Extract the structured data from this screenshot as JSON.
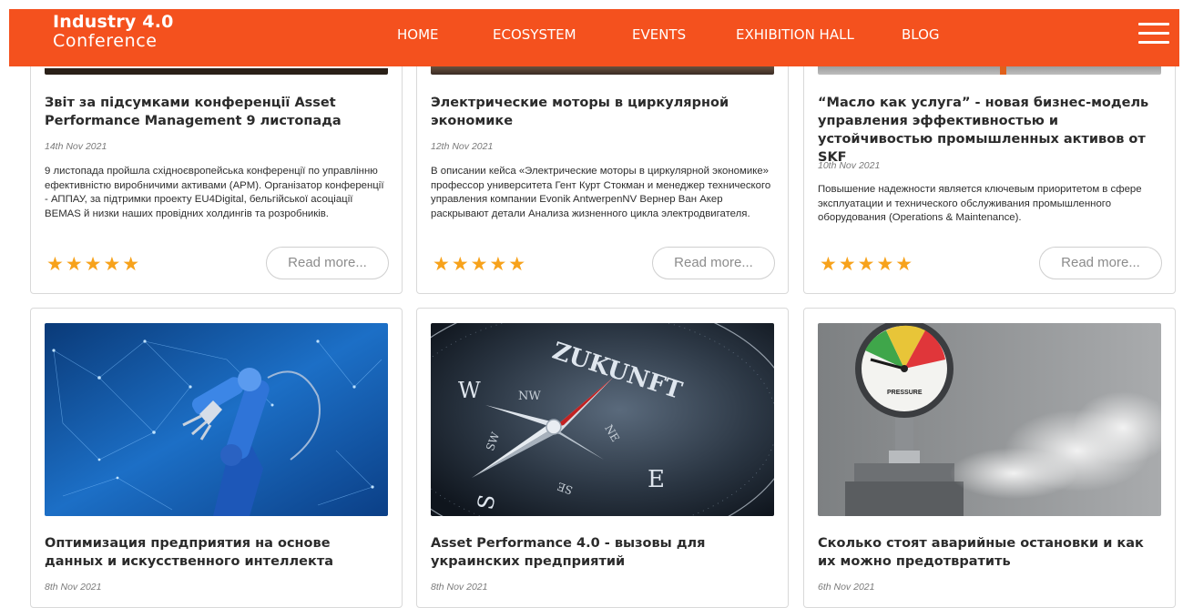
{
  "brand": {
    "line1": "Industry 4.0",
    "line2": "Conference"
  },
  "nav": [
    {
      "label": "HOME"
    },
    {
      "label": "ECOSYSTEM"
    },
    {
      "label": "EVENTS"
    },
    {
      "label": "EXHIBITION HALL"
    },
    {
      "label": "BLOG"
    }
  ],
  "colors": {
    "header": "#f4511e",
    "stars": "#f7a21b"
  },
  "read_more_label": "Read more...",
  "rating_stars": 5,
  "articles_top": [
    {
      "title": "Звіт за підсумками конференції Asset Performance Management 9 листопада",
      "date": "14th Nov 2021",
      "excerpt": "9 листопада пройшла східноєвропейська конференції по управлінню ефективністю виробничими активами (APM). Організатор конференції - АППАУ, за підтримки проекту EU4Digital, бельгійської асоціації BEMAS й низки наших провідних холдингів та розробників."
    },
    {
      "title": "Электрические моторы в циркулярной экономике",
      "date": "12th Nov 2021",
      "excerpt": "В описании кейса «Электрические моторы в циркулярной экономике» профессор университета Гент Курт Стокман и менеджер технического управления компании Evonik AntwerpenNV Вернер Ван Акер раскрывают детали Анализа жизненного цикла электродвигателя."
    },
    {
      "title": "“Масло как услуга” - новая бизнес-модель управления эффективностью и устойчивостью промышленных активов от SKF",
      "date": "10th Nov 2021",
      "excerpt": "Повышение надежности является ключевым приоритетом в сфере эксплуатации и технического обслуживания промышленного оборудования (Operations & Maintenance)."
    }
  ],
  "articles_bottom": [
    {
      "title": "Оптимизация предприятия на основе данных и искусственного интеллекта",
      "date": "8th Nov 2021"
    },
    {
      "title": "Asset Performance 4.0 - вызовы для украинских предприятий",
      "date": "8th Nov 2021"
    },
    {
      "title": "Сколько стоят аварийные остановки и как их можно предотвратить",
      "date": "6th Nov 2021"
    }
  ],
  "image_text": {
    "compass_word": "ZUKUNFT",
    "compass_w": "W",
    "compass_nw": "NW",
    "compass_ne": "NE",
    "compass_sw": "SW",
    "compass_se": "SE",
    "compass_e": "E",
    "compass_s": "S",
    "gauge_label": "PRESSURE"
  }
}
